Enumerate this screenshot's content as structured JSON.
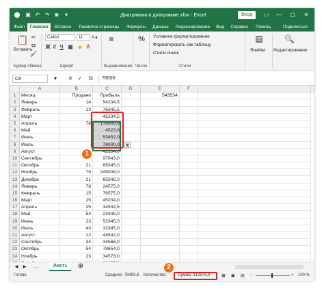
{
  "title": "Диаграмма в диаграмме.xlsx - Excel",
  "signin": "Вход",
  "tabs": [
    "Файл",
    "Главная",
    "Вставка",
    "Разметка страницы",
    "Формулы",
    "Данные",
    "Рецензирование",
    "Вид",
    "Справка",
    "Помощ",
    "Поделиться"
  ],
  "ribbon": {
    "paste": "Вставить",
    "clipboard": "Буфер обмена",
    "font_name": "Calibri",
    "font_size": "11",
    "font_group": "Шрифт",
    "alignment": "Выравнивание",
    "number": "Число",
    "cond_format": "Условное форматирование",
    "as_table": "Форматировать как таблицу",
    "cell_styles": "Стили ячеек",
    "styles": "Стили",
    "cells": "Ячейки",
    "editing": "Редактирование"
  },
  "namebox": "C8",
  "formula": "78000",
  "columns": [
    "A",
    "B",
    "C",
    "D",
    "E",
    "F"
  ],
  "rows": [
    {
      "n": "1",
      "a": "Месяц",
      "b": "Продано",
      "c": "Прибыль",
      "e": "543534"
    },
    {
      "n": "2",
      "a": "Январь",
      "b": "14",
      "c": "54234,5"
    },
    {
      "n": "3",
      "a": "Февраль",
      "b": "13",
      "c": "76345,5"
    },
    {
      "n": "4",
      "a": "Март",
      "b": "",
      "c": "45234,5"
    },
    {
      "n": "5",
      "a": "Апрель",
      "b": "76",
      "c": "178000,0"
    },
    {
      "n": "6",
      "a": "Май",
      "b": "",
      "c": "4523,0"
    },
    {
      "n": "7",
      "a": "Июнь",
      "b": "",
      "c": "53452,0"
    },
    {
      "n": "8",
      "a": "Июль",
      "b": "",
      "c": "78000,0"
    },
    {
      "n": "9",
      "a": "Август",
      "b": "",
      "c": "42334,0"
    },
    {
      "n": "10",
      "a": "Сентябрь",
      "b": "",
      "c": "97643,0"
    },
    {
      "n": "11",
      "a": "Октябрь",
      "b": "21",
      "c": "65345,0"
    },
    {
      "n": "12",
      "a": "Ноябрь",
      "b": "79",
      "c": "245008,0"
    },
    {
      "n": "13",
      "a": "Декабрь",
      "b": "21",
      "c": "65345,0"
    },
    {
      "n": "14",
      "a": "Январь",
      "b": "78",
      "c": "24575,0"
    },
    {
      "n": "15",
      "a": "Февраль",
      "b": "15",
      "c": "76575,0"
    },
    {
      "n": "16",
      "a": "Март",
      "b": "25",
      "c": "45234,0"
    },
    {
      "n": "17",
      "a": "Апрель",
      "b": "25",
      "c": "34534,5"
    },
    {
      "n": "18",
      "a": "Май",
      "b": "54",
      "c": "23445,0"
    },
    {
      "n": "19",
      "a": "Июнь",
      "b": "23",
      "c": "52345,0"
    },
    {
      "n": "20",
      "a": "Июль",
      "b": "43",
      "c": "32345,0"
    },
    {
      "n": "21",
      "a": "Август",
      "b": "12",
      "c": "44542,0"
    },
    {
      "n": "22",
      "a": "Сентябрь",
      "b": "34",
      "c": "34566,0"
    },
    {
      "n": "23",
      "a": "Октябрь",
      "b": "54",
      "c": "78654,0"
    },
    {
      "n": "24",
      "a": "Ноябрь",
      "b": "23",
      "c": "34578,0"
    },
    {
      "n": "25",
      "a": "Декабрь",
      "b": "12",
      "c": "23455,0"
    }
  ],
  "selected_rows": [
    5,
    6,
    7,
    8
  ],
  "sheet_tab": "Лист1",
  "status": {
    "ready": "Готово",
    "average": "Среднее: 78493,8",
    "count": "Количество:",
    "sum": "Сумма: 313975,0",
    "zoom": "100 %"
  },
  "callouts": [
    "1",
    "2"
  ],
  "colors": {
    "excel_green": "#217346",
    "highlight_red": "#e31b23",
    "callout_orange": "#e8701a"
  }
}
